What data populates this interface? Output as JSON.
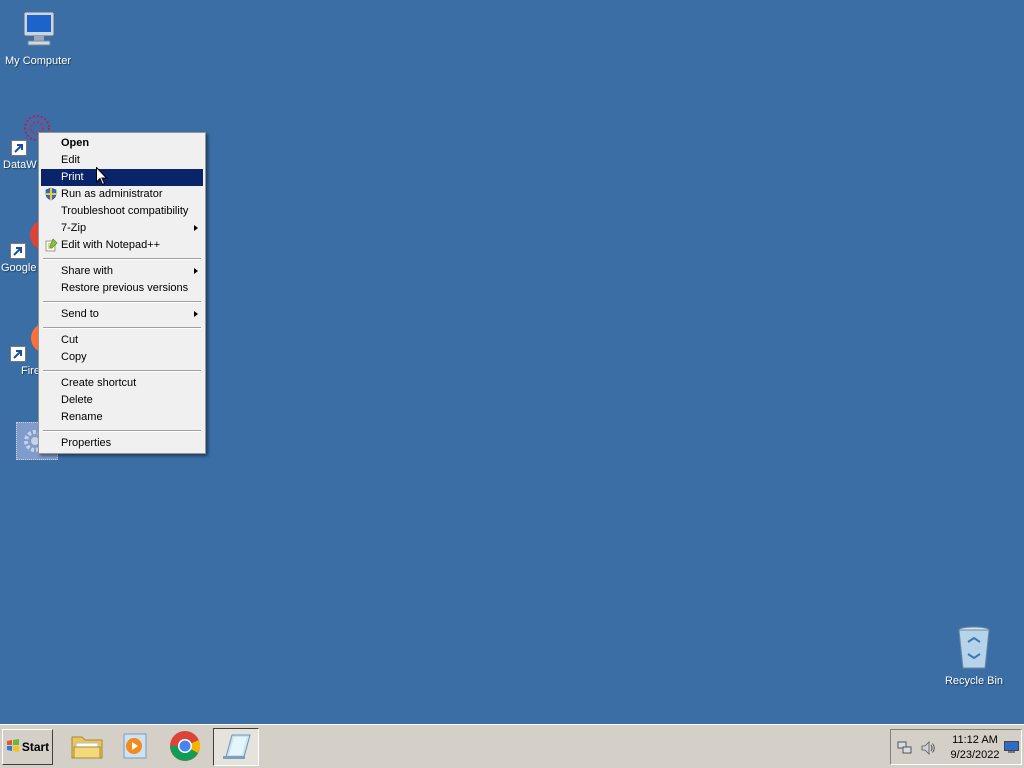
{
  "desktop": {
    "icons": [
      {
        "label": "My Computer"
      },
      {
        "label": "DataW"
      },
      {
        "label": "Google"
      },
      {
        "label": "Fire"
      },
      {
        "label": ""
      }
    ],
    "recycle_bin": {
      "label": "Recycle Bin"
    }
  },
  "context_menu": {
    "groups": [
      [
        "Open",
        "Edit",
        "Print",
        "Run as administrator",
        "Troubleshoot compatibility",
        "7-Zip",
        "Edit with Notepad++"
      ],
      [
        "Share with",
        "Restore previous versions"
      ],
      [
        "Send to"
      ],
      [
        "Cut",
        "Copy"
      ],
      [
        "Create shortcut",
        "Delete",
        "Rename"
      ],
      [
        "Properties"
      ]
    ],
    "highlighted": "Print",
    "default": "Open",
    "submenu_items": [
      "7-Zip",
      "Share with",
      "Send to"
    ]
  },
  "taskbar": {
    "start_label": "Start",
    "pinned": [
      "file-explorer",
      "media-player",
      "chrome",
      "notepad"
    ],
    "active": "notepad",
    "clock": {
      "time": "11:12 AM",
      "date": "9/23/2022"
    }
  },
  "colors": {
    "desktop": "#3a6ea5",
    "highlight": "#0a246a",
    "menu_bg": "#f0f0f0"
  }
}
